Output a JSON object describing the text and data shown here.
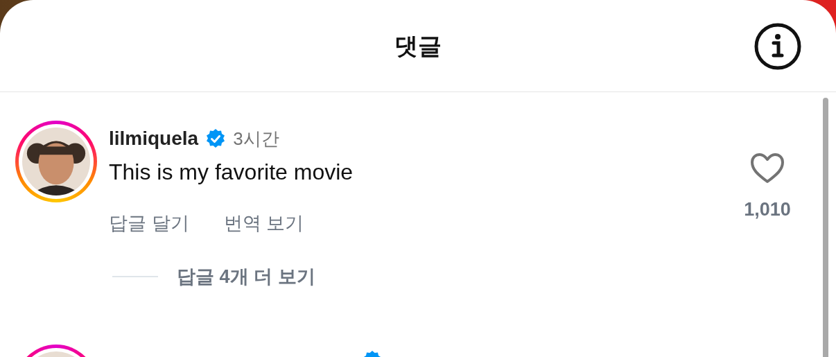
{
  "header": {
    "title": "댓글"
  },
  "comments": [
    {
      "username": "lilmiquela",
      "verified": true,
      "time": "3시간",
      "text": "This is my favorite movie",
      "actions": [
        "답글 달기",
        "번역 보기"
      ],
      "likes": "1,010",
      "liked": false,
      "more_replies": "답글 4개 더 보기"
    },
    {
      "verified": true
    }
  ]
}
